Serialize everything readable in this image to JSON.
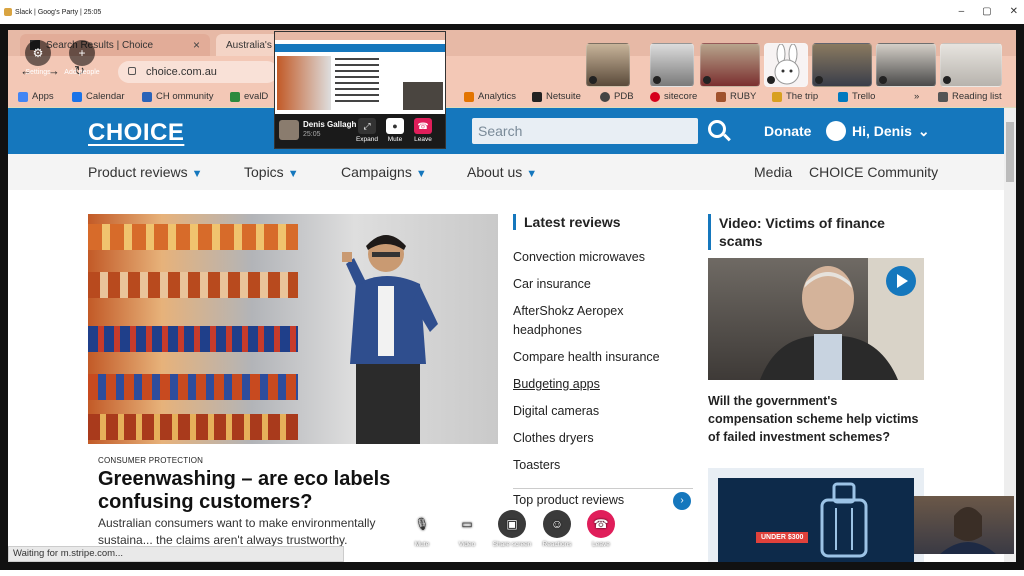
{
  "window": {
    "title": "Slack | Goog's Party | 25:05",
    "controls": [
      "–",
      "▢",
      "✕"
    ]
  },
  "browser": {
    "tabs": [
      {
        "label": "Search Results | Choice",
        "active": false
      },
      {
        "label": "Australia's",
        "active": true
      }
    ],
    "address": "choice.com.au",
    "bookmarks": [
      {
        "label": "Apps",
        "color": "#4285f4"
      },
      {
        "label": "Calendar",
        "color": "#1a73e8"
      },
      {
        "label": "CH ommunity",
        "color": "#2a63b8"
      },
      {
        "label": "evalD",
        "color": "#2c8a3e"
      },
      {
        "label": "Analytics",
        "color": "#e37400"
      },
      {
        "label": "Netsuite",
        "color": "#222222"
      },
      {
        "label": "PDB",
        "color": "#444444"
      },
      {
        "label": "sitecore",
        "color": "#d6001c"
      },
      {
        "label": "RUBY",
        "color": "#a0522d"
      },
      {
        "label": "The trip",
        "color": "#d8a020"
      },
      {
        "label": "Trello",
        "color": "#0079bf"
      },
      {
        "label": "»",
        "color": ""
      },
      {
        "label": "Reading list",
        "color": "#555555"
      }
    ]
  },
  "site": {
    "brand": "CHOICE",
    "search_placeholder": "Search",
    "donate": "Donate",
    "user": "Hi, Denis",
    "nav": [
      "Product reviews",
      "Topics",
      "Campaigns",
      "About us"
    ],
    "nav_right": [
      "Media",
      "CHOICE Community"
    ],
    "article": {
      "category": "CONSUMER PROTECTION",
      "headline": "Greenwashing – are eco labels confusing customers?",
      "standfirst": "Australian consumers want to make environmentally sustaina... the claims aren't always trustworthy."
    },
    "latest_reviews": {
      "title": "Latest reviews",
      "items": [
        "Convection microwaves",
        "Car insurance",
        "AfterShokz Aeropex headphones",
        "Compare health insurance",
        "Budgeting apps",
        "Digital cameras",
        "Clothes dryers",
        "Toasters"
      ],
      "top_link": "Top product reviews"
    },
    "video": {
      "title": "Video: Victims of finance scams",
      "caption": "Will the government's compensation scheme help victims of failed investment schemes?",
      "promo": "UNDER $300"
    },
    "status": "Waiting for m.stripe.com..."
  },
  "slack": {
    "top_controls": [
      {
        "label": "Settings",
        "icon": "gear-icon"
      },
      {
        "label": "Add people",
        "icon": "add-person-icon"
      }
    ],
    "mini": {
      "name": "Denis Gallagh",
      "time": "25:05",
      "buttons": [
        "Expand",
        "Mute",
        "Leave"
      ]
    },
    "callbar": [
      {
        "label": "Mute",
        "icon": "mic-icon"
      },
      {
        "label": "Video",
        "icon": "video-icon"
      },
      {
        "label": "Share screen",
        "icon": "screen-share-icon"
      },
      {
        "label": "Reactions",
        "icon": "emoji-icon"
      },
      {
        "label": "Leave",
        "icon": "hangup-icon"
      }
    ]
  }
}
